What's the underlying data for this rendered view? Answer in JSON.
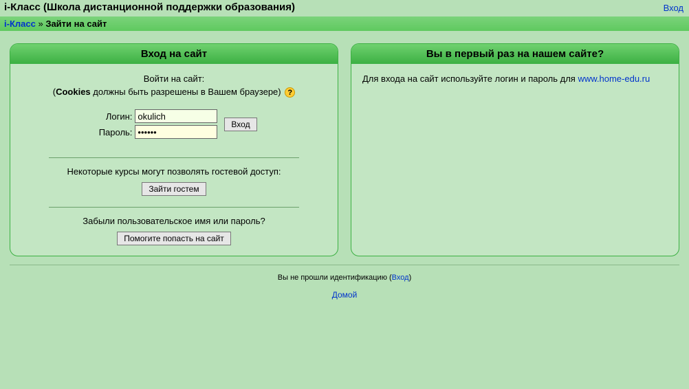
{
  "header": {
    "title": "i-Класс (Школа дистанционной поддержки образования)",
    "login_link": "Вход"
  },
  "breadcrumb": {
    "root": "i-Класс",
    "sep": "»",
    "current": "Зайти на сайт"
  },
  "left": {
    "title": "Вход на сайт",
    "instruction": "Войти на сайт:",
    "cookies_prefix": "(",
    "cookies_bold": "Cookies",
    "cookies_rest": " должны быть разрешены в Вашем браузере)",
    "help_icon": "?",
    "username_label": "Логин:",
    "username_value": "okulich",
    "password_label": "Пароль:",
    "password_value": "******",
    "submit": "Вход",
    "guest_text": "Некоторые курсы могут позволять гостевой доступ:",
    "guest_button": "Зайти гостем",
    "forgot_text": "Забыли пользовательское имя или пароль?",
    "help_button": "Помогите попасть на сайт"
  },
  "right": {
    "title": "Вы в первый раз на нашем сайте?",
    "text": "Для входа на сайт используйте логин и пароль для ",
    "link": "www.home-edu.ru"
  },
  "footer": {
    "not_logged_prefix": "Вы не прошли идентификацию (",
    "not_logged_link": "Вход",
    "not_logged_suffix": ")",
    "home": "Домой"
  }
}
